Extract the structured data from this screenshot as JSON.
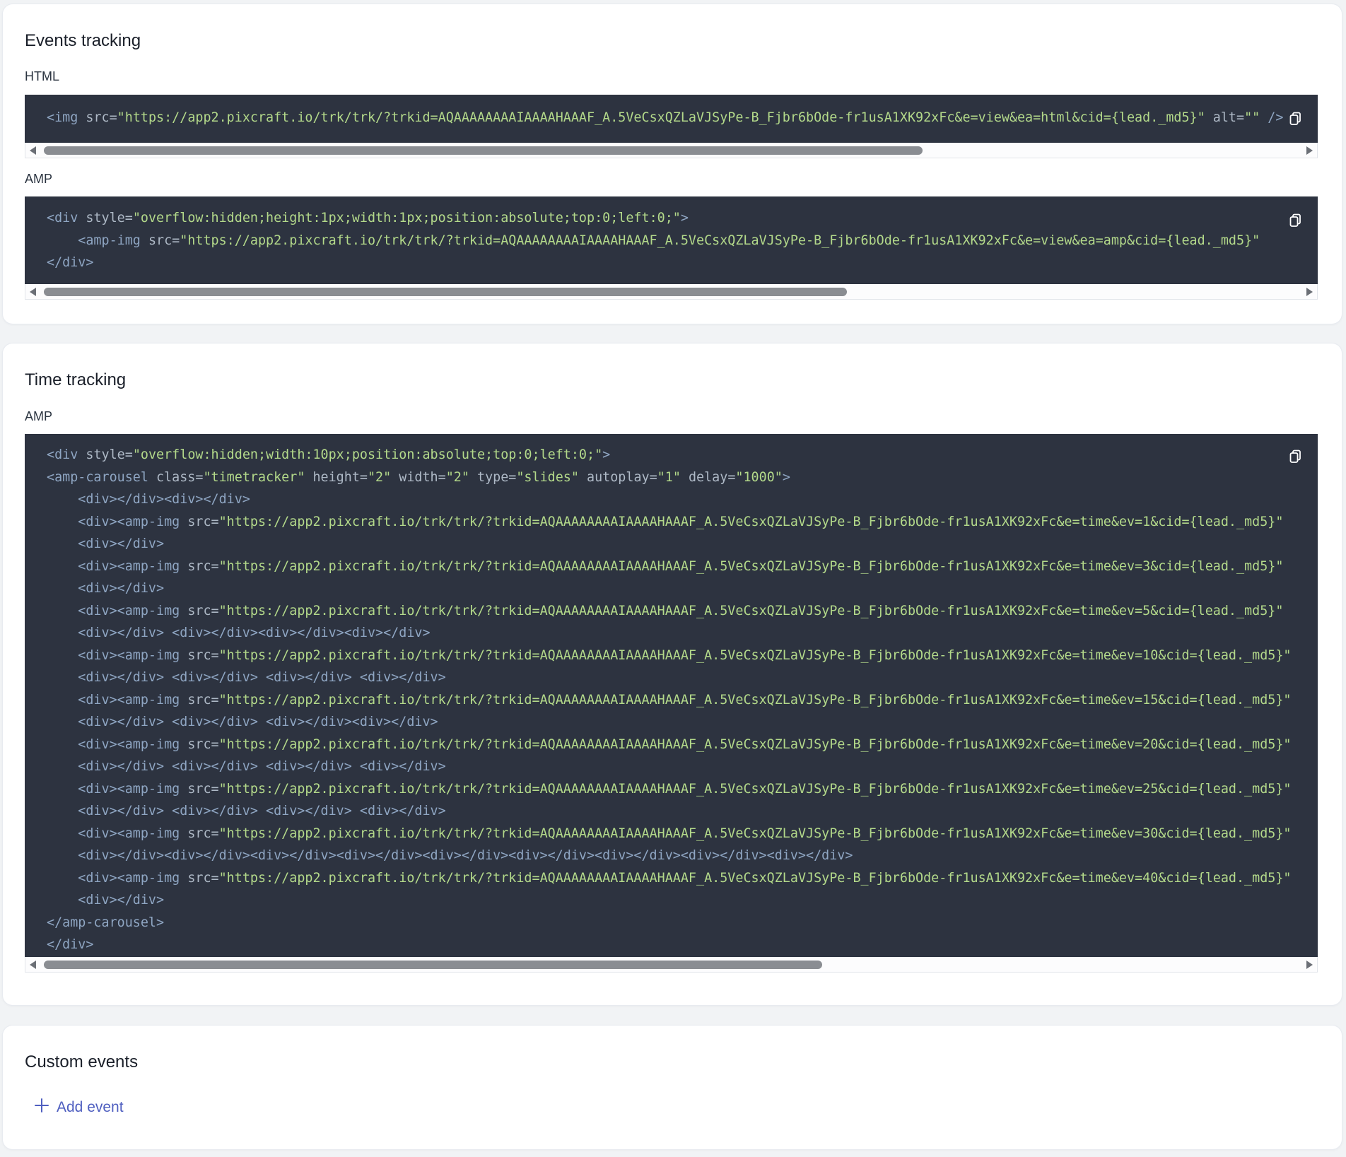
{
  "events_tracking": {
    "title": "Events tracking",
    "html_label": "HTML",
    "html_code": [
      [
        [
          "t",
          "<img "
        ],
        [
          "a",
          "src="
        ],
        [
          "s",
          "\"https://app2.pixcraft.io/trk/trk/?trkid=AQAAAAAAAAIAAAAHAAAF_A.5VeCsxQZLaVJSyPe-B_Fjbr6bOde-fr1usA1XK92xFc&e=view&ea=html&cid={lead._md5}\""
        ],
        [
          "a",
          " alt="
        ],
        [
          "s",
          "\"\""
        ],
        [
          "t",
          " />"
        ]
      ]
    ],
    "amp_label": "AMP",
    "amp_code": [
      [
        [
          "t",
          "<div "
        ],
        [
          "a",
          "style="
        ],
        [
          "s",
          "\"overflow:hidden;height:1px;width:1px;position:absolute;top:0;left:0;\""
        ],
        [
          "t",
          ">"
        ]
      ],
      [
        [
          "t",
          "    <amp-img "
        ],
        [
          "a",
          "src="
        ],
        [
          "s",
          "\"https://app2.pixcraft.io/trk/trk/?trkid=AQAAAAAAAAIAAAAHAAAF_A.5VeCsxQZLaVJSyPe-B_Fjbr6bOde-fr1usA1XK92xFc&e=view&ea=amp&cid={lead._md5}\""
        ]
      ],
      [
        [
          "t",
          "</div>"
        ]
      ]
    ]
  },
  "time_tracking": {
    "title": "Time tracking",
    "amp_label": "AMP",
    "amp_code": [
      [
        [
          "t",
          "<div "
        ],
        [
          "a",
          "style="
        ],
        [
          "s",
          "\"overflow:hidden;width:10px;position:absolute;top:0;left:0;\""
        ],
        [
          "t",
          ">"
        ]
      ],
      [
        [
          "t",
          "<amp-carousel "
        ],
        [
          "a",
          "class="
        ],
        [
          "s",
          "\"timetracker\""
        ],
        [
          "a",
          " height="
        ],
        [
          "s",
          "\"2\""
        ],
        [
          "a",
          " width="
        ],
        [
          "s",
          "\"2\""
        ],
        [
          "a",
          " type="
        ],
        [
          "s",
          "\"slides\""
        ],
        [
          "a",
          " autoplay="
        ],
        [
          "s",
          "\"1\""
        ],
        [
          "a",
          " delay="
        ],
        [
          "s",
          "\"1000\""
        ],
        [
          "t",
          ">"
        ]
      ],
      [
        [
          "t",
          "    <div></div><div></div>"
        ]
      ],
      [
        [
          "t",
          "    <div><amp-img "
        ],
        [
          "a",
          "src="
        ],
        [
          "s",
          "\"https://app2.pixcraft.io/trk/trk/?trkid=AQAAAAAAAAIAAAAHAAAF_A.5VeCsxQZLaVJSyPe-B_Fjbr6bOde-fr1usA1XK92xFc&e=time&ev=1&cid={lead._md5}\""
        ]
      ],
      [
        [
          "t",
          "    <div></div>"
        ]
      ],
      [
        [
          "t",
          "    <div><amp-img "
        ],
        [
          "a",
          "src="
        ],
        [
          "s",
          "\"https://app2.pixcraft.io/trk/trk/?trkid=AQAAAAAAAAIAAAAHAAAF_A.5VeCsxQZLaVJSyPe-B_Fjbr6bOde-fr1usA1XK92xFc&e=time&ev=3&cid={lead._md5}\""
        ]
      ],
      [
        [
          "t",
          "    <div></div>"
        ]
      ],
      [
        [
          "t",
          "    <div><amp-img "
        ],
        [
          "a",
          "src="
        ],
        [
          "s",
          "\"https://app2.pixcraft.io/trk/trk/?trkid=AQAAAAAAAAIAAAAHAAAF_A.5VeCsxQZLaVJSyPe-B_Fjbr6bOde-fr1usA1XK92xFc&e=time&ev=5&cid={lead._md5}\""
        ]
      ],
      [
        [
          "t",
          "    <div></div> <div></div><div></div><div></div>"
        ]
      ],
      [
        [
          "t",
          "    <div><amp-img "
        ],
        [
          "a",
          "src="
        ],
        [
          "s",
          "\"https://app2.pixcraft.io/trk/trk/?trkid=AQAAAAAAAAIAAAAHAAAF_A.5VeCsxQZLaVJSyPe-B_Fjbr6bOde-fr1usA1XK92xFc&e=time&ev=10&cid={lead._md5}\""
        ]
      ],
      [
        [
          "t",
          "    <div></div> <div></div> <div></div> <div></div>"
        ]
      ],
      [
        [
          "t",
          "    <div><amp-img "
        ],
        [
          "a",
          "src="
        ],
        [
          "s",
          "\"https://app2.pixcraft.io/trk/trk/?trkid=AQAAAAAAAAIAAAAHAAAF_A.5VeCsxQZLaVJSyPe-B_Fjbr6bOde-fr1usA1XK92xFc&e=time&ev=15&cid={lead._md5}\""
        ]
      ],
      [
        [
          "t",
          "    <div></div> <div></div> <div></div><div></div>"
        ]
      ],
      [
        [
          "t",
          "    <div><amp-img "
        ],
        [
          "a",
          "src="
        ],
        [
          "s",
          "\"https://app2.pixcraft.io/trk/trk/?trkid=AQAAAAAAAAIAAAAHAAAF_A.5VeCsxQZLaVJSyPe-B_Fjbr6bOde-fr1usA1XK92xFc&e=time&ev=20&cid={lead._md5}\""
        ]
      ],
      [
        [
          "t",
          "    <div></div> <div></div> <div></div> <div></div>"
        ]
      ],
      [
        [
          "t",
          "    <div><amp-img "
        ],
        [
          "a",
          "src="
        ],
        [
          "s",
          "\"https://app2.pixcraft.io/trk/trk/?trkid=AQAAAAAAAAIAAAAHAAAF_A.5VeCsxQZLaVJSyPe-B_Fjbr6bOde-fr1usA1XK92xFc&e=time&ev=25&cid={lead._md5}\""
        ]
      ],
      [
        [
          "t",
          "    <div></div> <div></div> <div></div> <div></div>"
        ]
      ],
      [
        [
          "t",
          "    <div><amp-img "
        ],
        [
          "a",
          "src="
        ],
        [
          "s",
          "\"https://app2.pixcraft.io/trk/trk/?trkid=AQAAAAAAAAIAAAAHAAAF_A.5VeCsxQZLaVJSyPe-B_Fjbr6bOde-fr1usA1XK92xFc&e=time&ev=30&cid={lead._md5}\""
        ]
      ],
      [
        [
          "t",
          "    <div></div><div></div><div></div><div></div><div></div><div></div><div></div><div></div><div></div>"
        ]
      ],
      [
        [
          "t",
          "    <div><amp-img "
        ],
        [
          "a",
          "src="
        ],
        [
          "s",
          "\"https://app2.pixcraft.io/trk/trk/?trkid=AQAAAAAAAAIAAAAHAAAF_A.5VeCsxQZLaVJSyPe-B_Fjbr6bOde-fr1usA1XK92xFc&e=time&ev=40&cid={lead._md5}\""
        ]
      ],
      [
        [
          "t",
          "    <div></div>"
        ]
      ],
      [
        [
          "t",
          "</amp-carousel>"
        ]
      ],
      [
        [
          "t",
          "</div>"
        ]
      ]
    ]
  },
  "custom_events": {
    "title": "Custom events",
    "add_event_label": "Add event"
  },
  "colors": {
    "code_background": "#2d3340",
    "tag": "#8fa6c3",
    "attribute": "#aeb9c6",
    "string": "#b3d98a",
    "accent": "#4f5fc0"
  },
  "icons": {
    "copy": "copy-icon",
    "add": "plus-icon",
    "scroll_left": "scroll-left-arrow",
    "scroll_right": "scroll-right-arrow"
  },
  "scrollbars": {
    "events_html_visible_fraction": 0.7,
    "events_amp_visible_fraction": 0.64,
    "time_amp_visible_fraction": 0.62
  }
}
